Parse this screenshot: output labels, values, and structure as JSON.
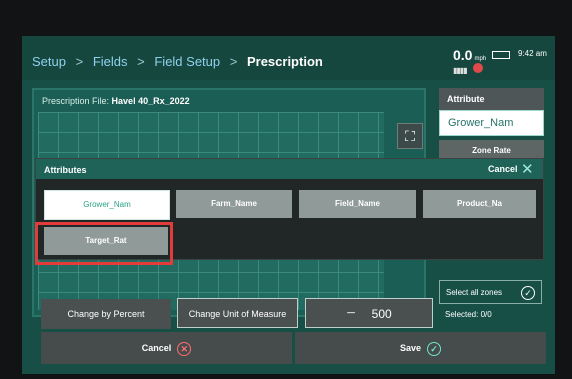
{
  "breadcrumb": {
    "setup": "Setup",
    "fields": "Fields",
    "field_setup": "Field Setup",
    "prescription": "Prescription",
    "separator": ">"
  },
  "status": {
    "speed": "0.0",
    "speed_unit": "mph",
    "clock": "9:42 am"
  },
  "prescription": {
    "file_label": "Prescription File:",
    "file_name": "Havel 40_Rx_2022"
  },
  "sidebar": {
    "attribute_label": "Attribute",
    "attribute_value": "Grower_Nam",
    "zone_rate": "Zone Rate"
  },
  "attributes_dialog": {
    "title": "Attributes",
    "cancel": "Cancel",
    "items": [
      "Grower_Nam",
      "Farm_Name",
      "Field_Name",
      "Product_Na",
      "Target_Rat"
    ]
  },
  "bottom": {
    "select_all": "Select all zones",
    "selected": "Selected: 0/0",
    "change_by_percent": "Change by Percent",
    "change_unit": "Change Unit of Measure",
    "minus": "−",
    "plus": "+",
    "step_value_1": "500",
    "step_value_2": "500",
    "cancel": "Cancel",
    "save": "Save"
  },
  "colors": {
    "accent": "#2aa287",
    "highlight": "#e33a3a"
  }
}
